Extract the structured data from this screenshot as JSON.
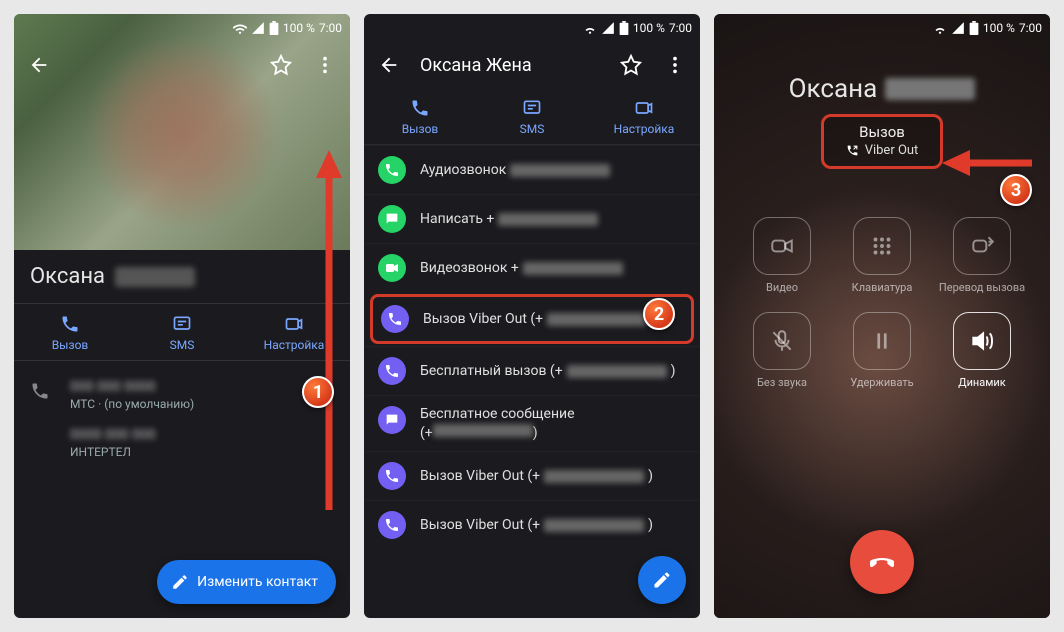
{
  "status": {
    "battery": "100 %",
    "time": "7:00"
  },
  "phone1": {
    "contactName": "Оксана",
    "actions": {
      "call": "Вызов",
      "sms": "SMS",
      "setup": "Настройка"
    },
    "carrier1": "МТС · (по умолчанию)",
    "carrier2": "ИНТЕРТЕЛ",
    "fab": "Изменить контакт"
  },
  "phone2": {
    "title": "Оксана Жена",
    "actions": {
      "call": "Вызов",
      "sms": "SMS",
      "setup": "Настройка"
    },
    "rows": {
      "r1": "Аудиозвонок",
      "r2": "Написать +",
      "r3": "Видеозвонок +",
      "r4a": "Вызов Viber Out (+",
      "r4b": ")",
      "r5a": "Бесплатный вызов (+",
      "r5b": ")",
      "r6a": "Бесплатное сообщение",
      "r6b": "(+",
      "r6c": ")",
      "r7a": "Вызов Viber Out (+",
      "r7b": ")",
      "r8a": "Вызов Viber Out (+",
      "r8b": ")"
    }
  },
  "phone3": {
    "name": "Оксана",
    "statusLine1": "Вызов",
    "statusLine2": "Viber Out",
    "buttons": {
      "video": "Видео",
      "keypad": "Клавиатура",
      "transfer": "Перевод вызова",
      "mute": "Без звука",
      "hold": "Удерживать",
      "speaker": "Динамик"
    }
  },
  "badges": {
    "b1": "1",
    "b2": "2",
    "b3": "3"
  }
}
